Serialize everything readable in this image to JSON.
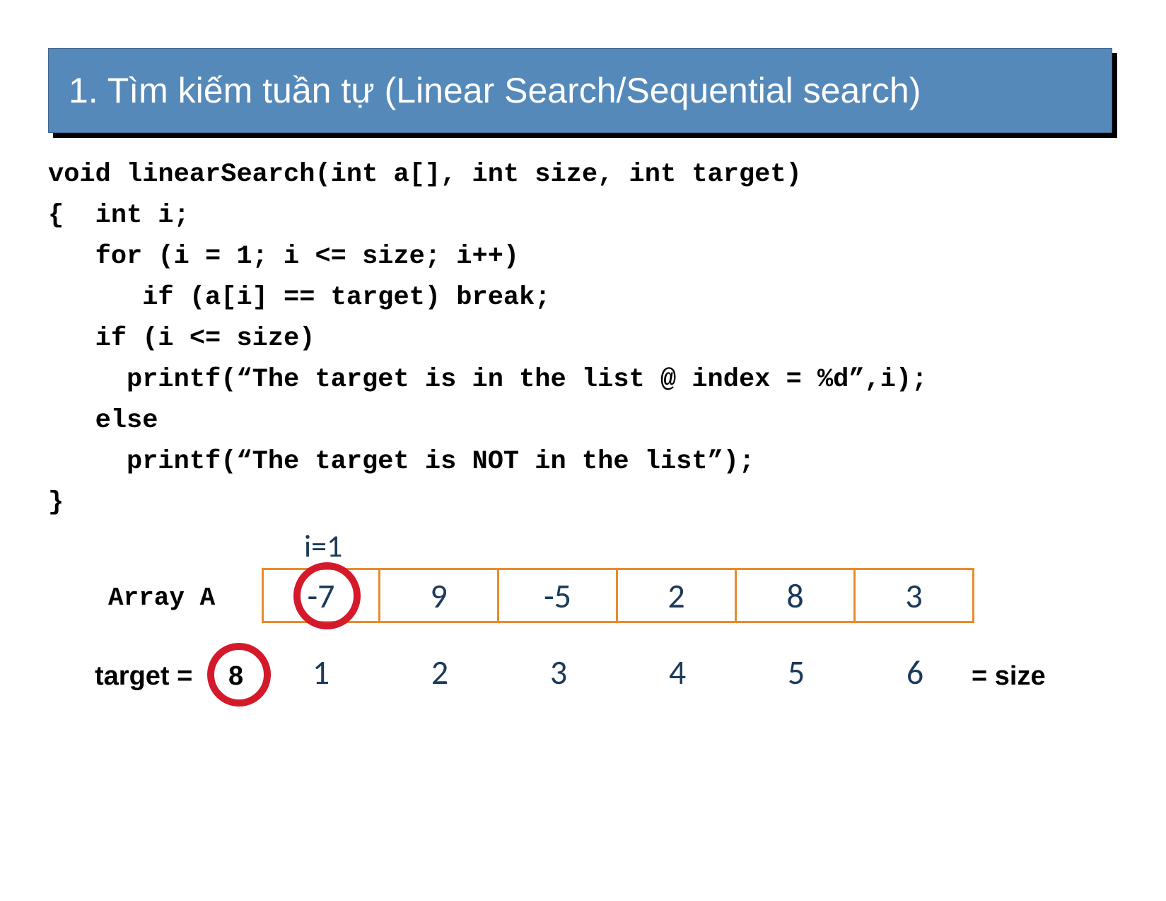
{
  "title": "1. Tìm kiếm tuần tự (Linear Search/Sequential search)",
  "code": {
    "l1": "void linearSearch(int a[], int size, int target)",
    "l2": "{  int i;",
    "l3": "   for (i = 1; i <= size; i++)",
    "l4": "      if (a[i] == target) break;",
    "l5": "   if (i <= size)",
    "l6": "     printf(“The target is in the list @ index = %d”,i);",
    "l7": "   else",
    "l8": "     printf(“The target is NOT in the list”);",
    "l9": "}"
  },
  "diagram": {
    "i_label": "i=1",
    "array_label": "Array A",
    "target_label": "target =",
    "target_value": "8",
    "size_label": "= size",
    "values": [
      "-7",
      "9",
      "-5",
      "2",
      "8",
      "3"
    ],
    "indices": [
      "1",
      "2",
      "3",
      "4",
      "5",
      "6"
    ]
  }
}
